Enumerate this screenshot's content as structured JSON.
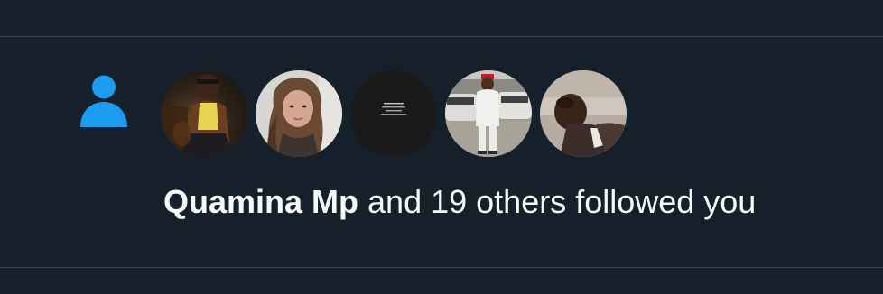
{
  "notification": {
    "icon": "person-icon",
    "follower_name": "Quamina Mp",
    "rest_text": " and 19 others followed you",
    "avatars": [
      {
        "name": "avatar-1"
      },
      {
        "name": "avatar-2"
      },
      {
        "name": "avatar-3"
      },
      {
        "name": "avatar-4"
      },
      {
        "name": "avatar-5"
      }
    ]
  },
  "colors": {
    "background": "#15202b",
    "divider": "#38444d",
    "accent": "#1d9bf0",
    "text": "#f7f9f9"
  }
}
